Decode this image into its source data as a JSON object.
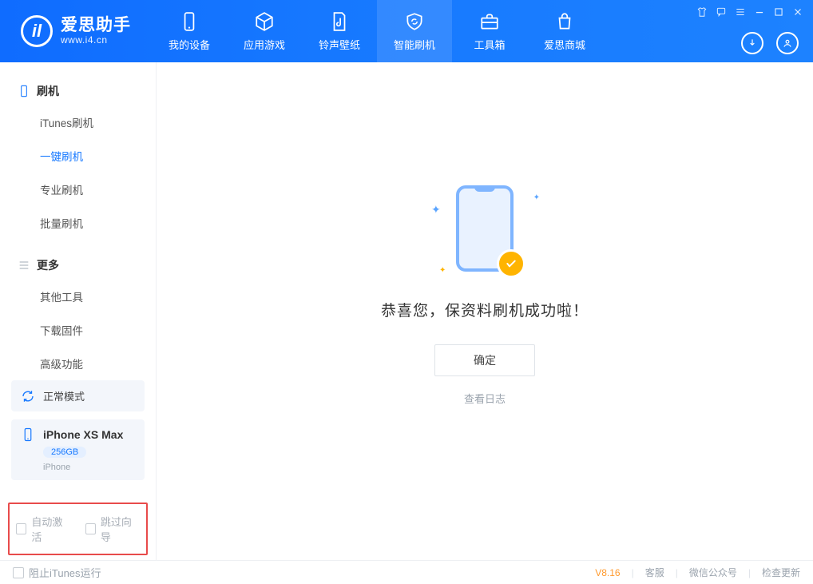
{
  "brand": {
    "title": "爱思助手",
    "subtitle": "www.i4.cn",
    "badge_letter": "il"
  },
  "nav": {
    "items": [
      {
        "label": "我的设备"
      },
      {
        "label": "应用游戏"
      },
      {
        "label": "铃声壁纸"
      },
      {
        "label": "智能刷机"
      },
      {
        "label": "工具箱"
      },
      {
        "label": "爱思商城"
      }
    ],
    "active_index": 3
  },
  "sidebar": {
    "section_flash": "刷机",
    "flash_items": [
      {
        "label": "iTunes刷机"
      },
      {
        "label": "一键刷机"
      },
      {
        "label": "专业刷机"
      },
      {
        "label": "批量刷机"
      }
    ],
    "flash_active_index": 1,
    "section_more": "更多",
    "more_items": [
      {
        "label": "其他工具"
      },
      {
        "label": "下载固件"
      },
      {
        "label": "高级功能"
      }
    ],
    "device_mode": "正常模式",
    "device_name": "iPhone XS Max",
    "device_storage": "256GB",
    "device_type": "iPhone",
    "opt_auto_activate": "自动激活",
    "opt_skip_guide": "跳过向导"
  },
  "main": {
    "success_text": "恭喜您，保资料刷机成功啦！",
    "ok_label": "确定",
    "view_log_label": "查看日志"
  },
  "footer": {
    "block_itunes": "阻止iTunes运行",
    "version": "V8.16",
    "links": [
      "客服",
      "微信公众号",
      "检查更新"
    ]
  }
}
